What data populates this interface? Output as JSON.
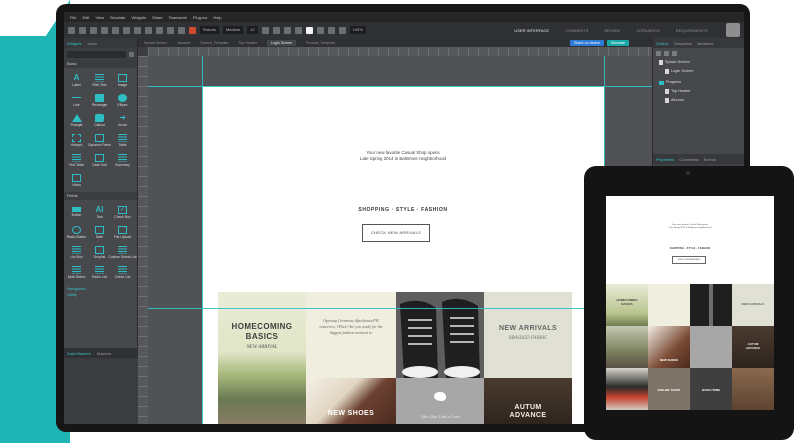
{
  "colors": {
    "teal": "#1fb5b5",
    "accent": "#2dbdc3",
    "editor_bg": "#3b3d40"
  },
  "menu": [
    "File",
    "Edit",
    "View",
    "Simulate",
    "Widgets",
    "Share",
    "Teamwork",
    "Plug-ins",
    "Help"
  ],
  "toolbar": {
    "font": "Roboto",
    "weight": "Medium",
    "size": "12",
    "zoom": "100%",
    "tabs": [
      "USER INTERFACE",
      "COMMENTS",
      "REVIEW",
      "SCENARIOS",
      "REQUIREMENTS"
    ]
  },
  "left_panel": {
    "tabs": [
      "Widgets",
      "Icons"
    ],
    "section_basic": "Basic",
    "basic_widgets": [
      {
        "label": "Label",
        "icon": "label-icon"
      },
      {
        "label": "Rich Text",
        "icon": "rich-text-icon"
      },
      {
        "label": "Image",
        "icon": "image-icon"
      },
      {
        "label": "Line",
        "icon": "line-icon"
      },
      {
        "label": "Rectangle",
        "icon": "rectangle-icon"
      },
      {
        "label": "Ellipse",
        "icon": "ellipse-icon"
      },
      {
        "label": "Triangle",
        "icon": "triangle-icon"
      },
      {
        "label": "Callout",
        "icon": "callout-icon"
      },
      {
        "label": "Arrow",
        "icon": "arrow-icon"
      },
      {
        "label": "Hotspot",
        "icon": "hotspot-icon"
      },
      {
        "label": "Dynamic Panel",
        "icon": "dynamic-panel-icon"
      },
      {
        "label": "Table",
        "icon": "table-icon"
      },
      {
        "label": "Text Table",
        "icon": "text-table-icon"
      },
      {
        "label": "Data Grid",
        "icon": "data-grid-icon"
      },
      {
        "label": "Summary",
        "icon": "summary-icon"
      },
      {
        "label": "Video",
        "icon": "video-icon"
      }
    ],
    "section_fields": "Fields",
    "field_widgets": [
      {
        "label": "Button",
        "icon": "button-icon"
      },
      {
        "label": "Text",
        "icon": "text-field-icon"
      },
      {
        "label": "Check Box",
        "icon": "checkbox-icon"
      },
      {
        "label": "Radio Button",
        "icon": "radio-button-icon"
      },
      {
        "label": "Date",
        "icon": "date-icon"
      },
      {
        "label": "File Upload",
        "icon": "file-upload-icon"
      },
      {
        "label": "List Box",
        "icon": "list-box-icon"
      },
      {
        "label": "Droplist",
        "icon": "droplist-icon"
      },
      {
        "label": "Custom Select List",
        "icon": "custom-select-icon"
      },
      {
        "label": "Multi Select",
        "icon": "multi-select-icon"
      },
      {
        "label": "Radio List",
        "icon": "radio-list-icon"
      },
      {
        "label": "Check List",
        "icon": "check-list-icon"
      }
    ],
    "section_links": [
      "Navigation",
      "Utility"
    ],
    "masters_tabs": [
      "Data Masters",
      "Masters"
    ]
  },
  "doc_tabs": [
    "Splash Screen",
    "Account",
    "Search_Template",
    "Top Header",
    "Login Screen",
    "Product_Template"
  ],
  "doc_tab_active": "Login Screen",
  "actions": {
    "share": "Share on device",
    "simulate": "Simulate"
  },
  "canvas": {
    "tagline_line1": "Your new favorite Casual Shop opens",
    "tagline_line2": "Late Spring 2014 in Baltimore neighborhood",
    "nav": "SHOPPING  ·  STYLE  ·  FASHION",
    "cta": "CHECK NEW ARRIVALS",
    "tile_homecoming_title": "HOMECOMING BASICS",
    "tile_homecoming_sub": "NEW ARRIVAL",
    "tile_quote": "Opening Ceremony  #fashionsx/FW tomorrow, 1Fkes! Are you ready for the biggest fashion moment to",
    "tile_arrivals_title": "NEW ARRIVALS",
    "tile_arrivals_sub": "BRAIDED FABRIC",
    "tile_shoes_title": "NEW SHOES",
    "tile_social": "Like, Like, Like, a Love",
    "tile_autumn_title": "AUTUM ADVANCE"
  },
  "right_panel": {
    "tabs": [
      "Outline",
      "Templates",
      "Variables"
    ],
    "tree": [
      {
        "label": "Splash Screen",
        "type": "doc"
      },
      {
        "label": "Login Screen",
        "type": "doc"
      },
      {
        "label": "Progress",
        "type": "folder"
      },
      {
        "label": "Top Header",
        "type": "doc"
      },
      {
        "label": "Albums",
        "type": "doc"
      }
    ],
    "props_tabs": [
      "Properties",
      "Comments",
      "Events"
    ],
    "selected": "Rectangle",
    "variants_link": "Variants"
  },
  "tablet": {
    "tile_homecoming": "HOMECOMING BASICS",
    "tile_arrivals": "NEW ARRIVALS",
    "tile_new_shoes": "NEW SHOES",
    "tile_autumn": "AUTUM ADVANCE",
    "tile_basic_tshirt": "EVELINE TSHIRT",
    "tile_basic_item": "BASIC ITEMS",
    "nav": "SHOPPING  ·  STYLE  ·  FASHION",
    "cta": "CHECK NEW ARRIVALS"
  }
}
